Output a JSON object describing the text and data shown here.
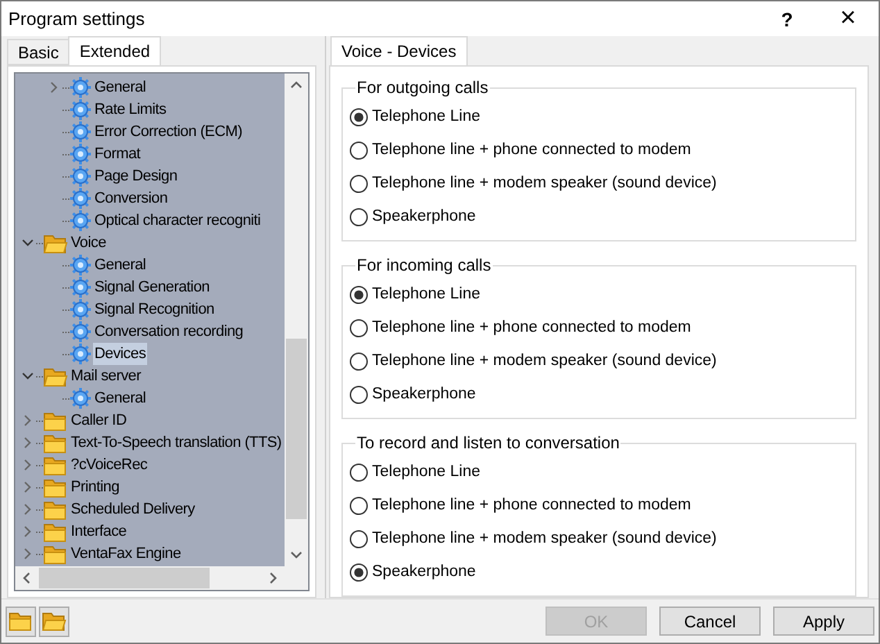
{
  "window": {
    "title": "Program settings",
    "help": "?",
    "close": "×"
  },
  "left_tabs": [
    {
      "label": "Basic",
      "selected": false
    },
    {
      "label": "Extended",
      "selected": true
    }
  ],
  "tree": {
    "leading_items": [
      {
        "label": "General",
        "kind": "gear",
        "expanded": false,
        "selected": false
      },
      {
        "label": "Rate Limits",
        "kind": "gear",
        "selected": false
      },
      {
        "label": "Error Correction (ECM)",
        "kind": "gear",
        "selected": false
      },
      {
        "label": "Format",
        "kind": "gear",
        "selected": false
      },
      {
        "label": "Page Design",
        "kind": "gear",
        "selected": false
      },
      {
        "label": "Conversion",
        "kind": "gear",
        "selected": false
      },
      {
        "label": "Optical character recogniti",
        "kind": "gear",
        "selected": false
      }
    ],
    "items": [
      {
        "label": "Voice",
        "kind": "folder",
        "expanded": true,
        "selected": false,
        "children": [
          {
            "label": "General",
            "kind": "gear",
            "selected": false
          },
          {
            "label": "Signal Generation",
            "kind": "gear",
            "selected": false
          },
          {
            "label": "Signal Recognition",
            "kind": "gear",
            "selected": false
          },
          {
            "label": "Conversation recording",
            "kind": "gear",
            "selected": false
          },
          {
            "label": "Devices",
            "kind": "gear",
            "selected": true
          }
        ]
      },
      {
        "label": "Mail server",
        "kind": "folder",
        "expanded": true,
        "selected": false,
        "children": [
          {
            "label": "General",
            "kind": "gear",
            "selected": false
          }
        ]
      },
      {
        "label": "Caller ID",
        "kind": "folder",
        "expanded": false,
        "selected": false
      },
      {
        "label": "Text-To-Speech translation (TTS)",
        "kind": "folder",
        "expanded": false,
        "selected": false
      },
      {
        "label": "?cVoiceRec",
        "kind": "folder",
        "expanded": false,
        "selected": false
      },
      {
        "label": "Printing",
        "kind": "folder",
        "expanded": false,
        "selected": false
      },
      {
        "label": "Scheduled Delivery",
        "kind": "folder",
        "expanded": false,
        "selected": false
      },
      {
        "label": "Interface",
        "kind": "folder",
        "expanded": false,
        "selected": false
      },
      {
        "label": "VentaFax Engine",
        "kind": "folder",
        "expanded": false,
        "selected": false
      }
    ]
  },
  "right_tabs": [
    {
      "label": "Voice - Devices",
      "selected": true
    }
  ],
  "groups": [
    {
      "title": "For outgoing calls",
      "options": [
        {
          "label": "Telephone Line",
          "selected": true
        },
        {
          "label": "Telephone line + phone connected to modem",
          "selected": false
        },
        {
          "label": "Telephone line + modem speaker (sound device)",
          "selected": false
        },
        {
          "label": "Speakerphone",
          "selected": false
        }
      ]
    },
    {
      "title": "For incoming calls",
      "options": [
        {
          "label": "Telephone Line",
          "selected": true
        },
        {
          "label": "Telephone line + phone connected to modem",
          "selected": false
        },
        {
          "label": "Telephone line + modem speaker (sound device)",
          "selected": false
        },
        {
          "label": "Speakerphone",
          "selected": false
        }
      ]
    },
    {
      "title": "To record and listen to conversation",
      "options": [
        {
          "label": "Telephone Line",
          "selected": false
        },
        {
          "label": "Telephone line + phone connected to modem",
          "selected": false
        },
        {
          "label": "Telephone line + modem speaker (sound device)",
          "selected": false
        },
        {
          "label": "Speakerphone",
          "selected": true
        }
      ]
    }
  ],
  "buttons": [
    {
      "label": "OK",
      "disabled": true
    },
    {
      "label": "Cancel",
      "disabled": false
    },
    {
      "label": "Apply",
      "disabled": false
    }
  ]
}
